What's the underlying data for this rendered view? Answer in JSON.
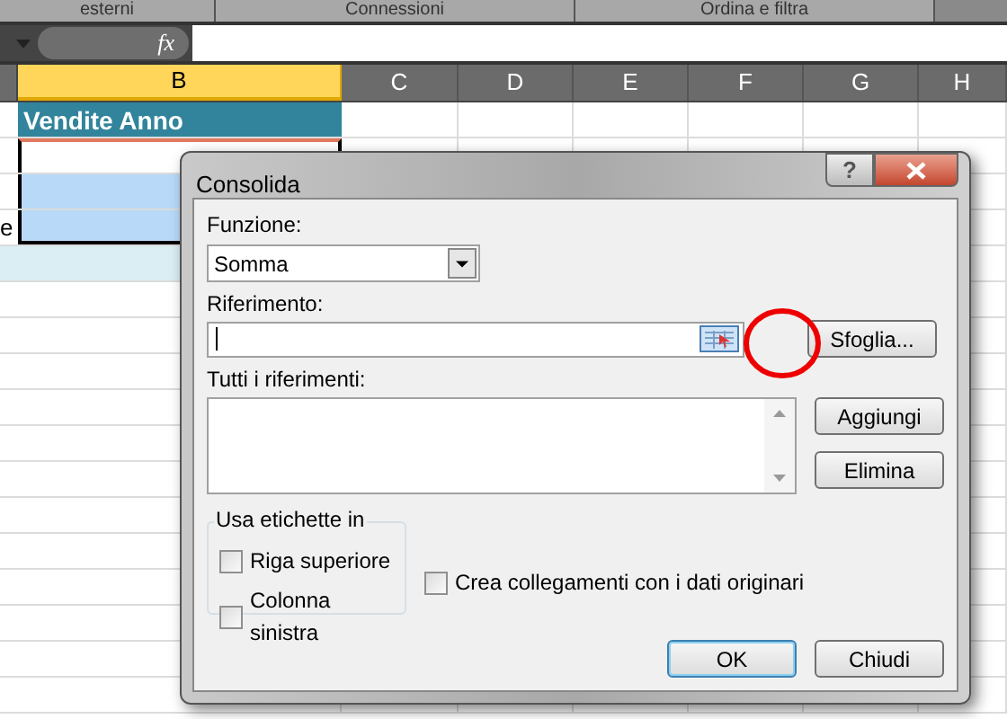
{
  "ribbon_groups": [
    "esterni",
    "Connessioni",
    "Ordina e filtra"
  ],
  "formula_bar": {
    "fx": "fx"
  },
  "columns": [
    {
      "label": "B",
      "selected": true
    },
    {
      "label": "C",
      "selected": false
    },
    {
      "label": "D",
      "selected": false
    },
    {
      "label": "E",
      "selected": false
    },
    {
      "label": "F",
      "selected": false
    },
    {
      "label": "G",
      "selected": false
    },
    {
      "label": "H",
      "selected": false
    }
  ],
  "sheet": {
    "header_cell": "Vendite Anno",
    "column_a_fragment": "e"
  },
  "dialog": {
    "title": "Consolida",
    "help": "?",
    "function_label": "Funzione:",
    "function_value": "Somma",
    "reference_label": "Riferimento:",
    "browse_button": "Sfoglia...",
    "all_references_label": "Tutti i riferimenti:",
    "add_button": "Aggiungi",
    "delete_button": "Elimina",
    "labels_group": "Usa etichette in",
    "checkboxes": [
      {
        "label": "Riga superiore",
        "checked": false
      },
      {
        "label": "Colonna sinistra",
        "checked": false
      },
      {
        "label": "Crea collegamenti con i dati originari",
        "checked": false
      }
    ],
    "buttons": [
      {
        "label": "OK",
        "default": true
      },
      {
        "label": "Chiudi",
        "default": false
      }
    ]
  }
}
